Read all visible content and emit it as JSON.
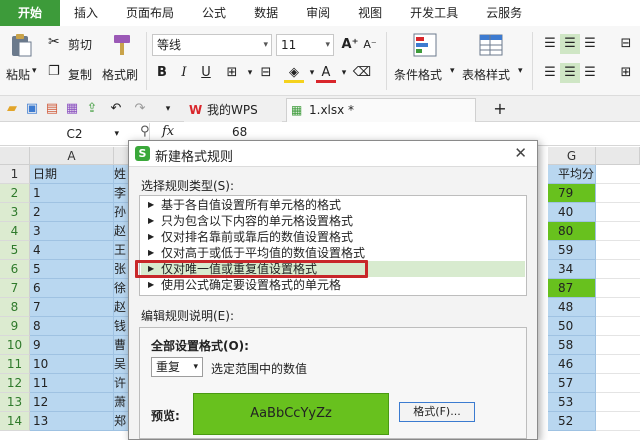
{
  "ribbon_tabs": [
    "开始",
    "插入",
    "页面布局",
    "公式",
    "数据",
    "审阅",
    "视图",
    "开发工具",
    "云服务"
  ],
  "ribbon": {
    "paste": "粘贴",
    "cut": "剪切",
    "copy": "复制",
    "format_painter": "格式刷",
    "font_name": "等线",
    "font_size": "11",
    "bold": "B",
    "italic": "I",
    "underline": "U",
    "conditional_format": "条件格式",
    "table_style": "表格样式"
  },
  "doc_tabs": {
    "wps": "我的WPS",
    "file": "1.xlsx *",
    "add": "+"
  },
  "formula_bar": {
    "name_box": "C2",
    "fx": "fx",
    "value": "68"
  },
  "columns": [
    "A",
    "G"
  ],
  "rows": [
    {
      "n": "1",
      "a": "日期",
      "b": "姓",
      "g": "平均分",
      "green": false,
      "hdr": true
    },
    {
      "n": "2",
      "a": "1",
      "b": "李",
      "g": "79",
      "green": true
    },
    {
      "n": "3",
      "a": "2",
      "b": "孙",
      "g": "40",
      "green": false
    },
    {
      "n": "4",
      "a": "3",
      "b": "赵",
      "g": "80",
      "green": true
    },
    {
      "n": "5",
      "a": "4",
      "b": "王",
      "g": "59",
      "green": false
    },
    {
      "n": "6",
      "a": "5",
      "b": "张",
      "g": "34",
      "green": false
    },
    {
      "n": "7",
      "a": "6",
      "b": "徐",
      "g": "87",
      "green": true
    },
    {
      "n": "8",
      "a": "7",
      "b": "赵",
      "g": "48",
      "green": false
    },
    {
      "n": "9",
      "a": "8",
      "b": "钱",
      "g": "50",
      "green": false
    },
    {
      "n": "10",
      "a": "9",
      "b": "曹",
      "g": "58",
      "green": false
    },
    {
      "n": "11",
      "a": "10",
      "b": "吴",
      "g": "46",
      "green": false
    },
    {
      "n": "12",
      "a": "11",
      "b": "许",
      "g": "57",
      "green": false
    },
    {
      "n": "13",
      "a": "12",
      "b": "萧",
      "g": "53",
      "green": false
    },
    {
      "n": "14",
      "a": "13",
      "b": "郑",
      "g": "52",
      "green": false
    }
  ],
  "dialog": {
    "title": "新建格式规则",
    "close": "✕",
    "rule_type_label": "选择规则类型(S):",
    "rules": [
      "基于各自值设置所有单元格的格式",
      "只为包含以下内容的单元格设置格式",
      "仅对排名靠前或靠后的数值设置格式",
      "仅对高于或低于平均值的数值设置格式",
      "仅对唯一值或重复值设置格式",
      "使用公式确定要设置格式的单元格"
    ],
    "selected_rule_index": 4,
    "edit_label": "编辑规则说明(E):",
    "format_all_label": "全部设置格式(O):",
    "dup_select": "重复",
    "dup_suffix": "选定范围中的数值",
    "preview_label": "预览:",
    "preview_text": "AaBbCcYyZz",
    "format_button": "格式(F)..."
  },
  "colors": {
    "accent": "#3d9b3a",
    "highlight_fill": "#68c11e",
    "selection_fill": "#b9d7f0",
    "callout_red": "#c8282a"
  }
}
